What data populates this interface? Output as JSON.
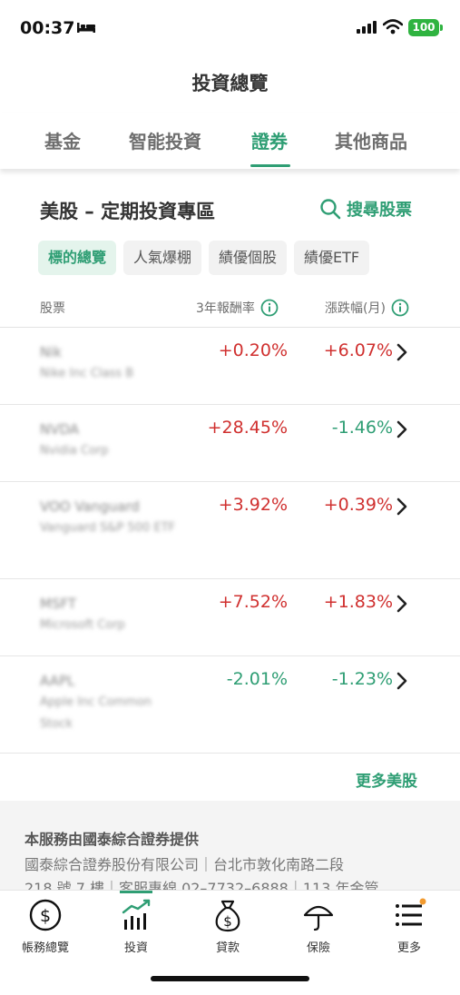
{
  "status": {
    "time": "00:37",
    "battery": "100"
  },
  "header": {
    "title": "投資總覽"
  },
  "tabs": [
    {
      "label": "基金",
      "active": false
    },
    {
      "label": "智能投資",
      "active": false
    },
    {
      "label": "證券",
      "active": true
    },
    {
      "label": "其他商品",
      "active": false
    }
  ],
  "section": {
    "title": "美股 – 定期投資專區",
    "search_label": "搜尋股票"
  },
  "chips": [
    {
      "label": "標的總覽",
      "active": true
    },
    {
      "label": "人氣爆棚",
      "active": false
    },
    {
      "label": "績優個股",
      "active": false
    },
    {
      "label": "績優ETF",
      "active": false
    }
  ],
  "columns": {
    "stock": "股票",
    "return_3y": "3年報酬率",
    "change_month": "漲跌幅(月)"
  },
  "rows": [
    {
      "name": "Nik",
      "sub": "Nike Inc Class B",
      "return_3y": "+0.20%",
      "change_month": "+6.07%"
    },
    {
      "name": "NVDA",
      "sub": "Nvidia Corp",
      "return_3y": "+28.45%",
      "change_month": "-1.46%"
    },
    {
      "name": "VOO Vanguard",
      "sub": "Vanguard S&P 500 ETF",
      "return_3y": "+3.92%",
      "change_month": "+0.39%"
    },
    {
      "name": "MSFT",
      "sub": "Microsoft Corp",
      "return_3y": "+7.52%",
      "change_month": "+1.83%"
    },
    {
      "name": "AAPL",
      "sub": "Apple Inc Common Stock",
      "return_3y": "-2.01%",
      "change_month": "-1.23%"
    }
  ],
  "more_label": "更多美股",
  "disclaimer": {
    "title": "本服務由國泰綜合證券提供",
    "line1": "國泰綜合證券股份有限公司｜台北市敦化南路二段",
    "line2": "218 號 7 樓｜客服專線 02–7732–6888｜113 年金管"
  },
  "nav": [
    {
      "label": "帳務總覽",
      "icon": "dollar-circle-icon"
    },
    {
      "label": "投資",
      "icon": "bar-chart-trend-icon",
      "active": true
    },
    {
      "label": "貸款",
      "icon": "money-bag-icon"
    },
    {
      "label": "保險",
      "icon": "umbrella-icon"
    },
    {
      "label": "更多",
      "icon": "menu-list-icon",
      "badge": true
    }
  ],
  "colors": {
    "accent": "#2f9e74",
    "up": "#d0302f",
    "down": "#2f9e74"
  }
}
